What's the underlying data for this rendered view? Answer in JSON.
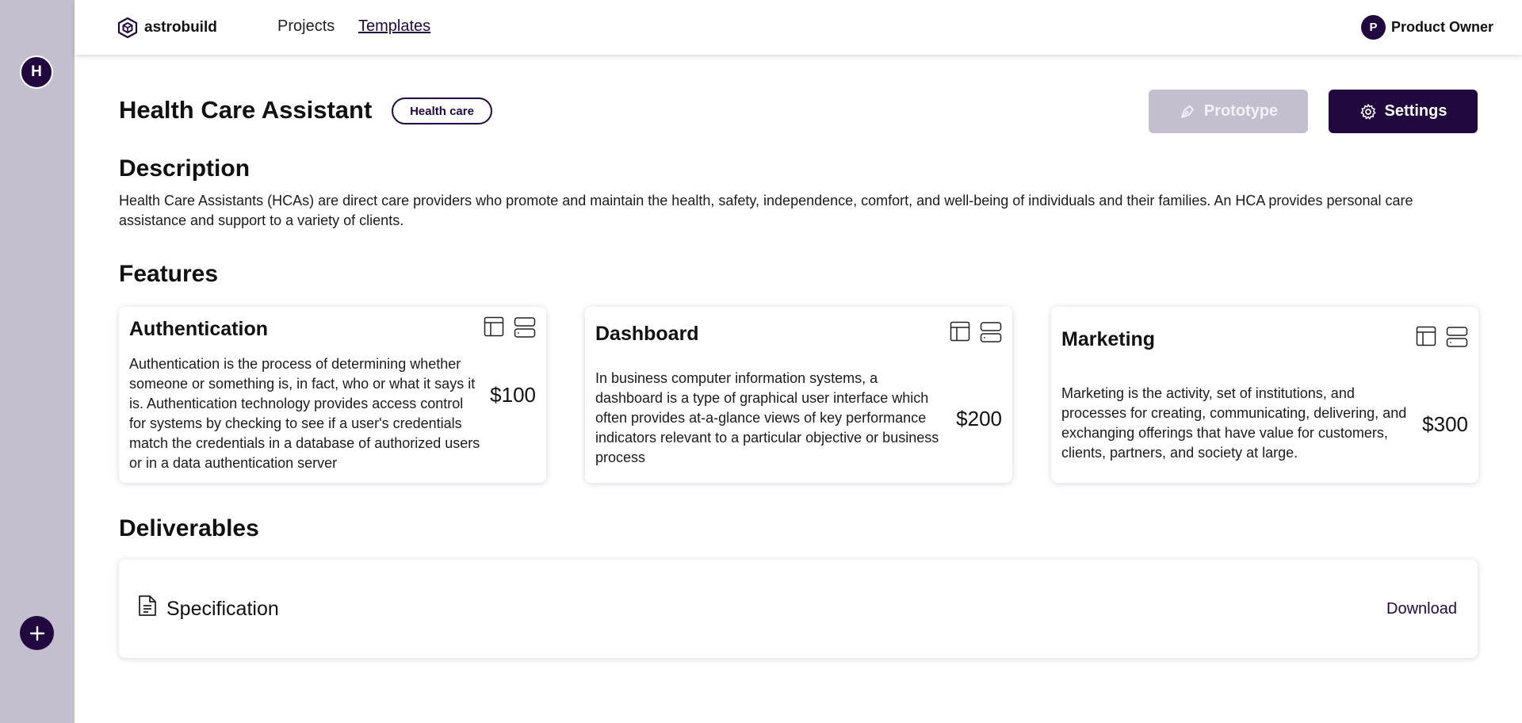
{
  "sidebar": {
    "workspace_initial": "H"
  },
  "header": {
    "logo": "astrobuild",
    "nav": [
      "Projects",
      "Templates"
    ],
    "user": {
      "initial": "P",
      "name": "Product Owner"
    }
  },
  "template": {
    "title": "Health Care Assistant",
    "tag": "Health care",
    "prototype_label": "Prototype",
    "settings_label": "Settings"
  },
  "description": {
    "heading": "Description",
    "text": "Health Care Assistants (HCAs) are direct care providers who promote and maintain the health, safety, independence, comfort, and well-being of individuals and their families. An HCA provides personal care assistance and support to a variety of clients."
  },
  "features": {
    "heading": "Features",
    "items": [
      {
        "title": "Authentication",
        "description": "Authentication is the process of determining whether someone or something is, in fact, who or what it says it is. Authentication technology provides access control for systems by checking to see if a user's credentials match the credentials in a database of authorized users or in a data authentication server",
        "price": "$100"
      },
      {
        "title": "Dashboard",
        "description": "In business computer information systems, a dashboard is a type of graphical user interface which often provides at-a-glance views of key performance indicators relevant to a particular objective or business process",
        "price": "$200"
      },
      {
        "title": "Marketing",
        "description": "Marketing is the activity, set of institutions, and processes for creating, communicating, delivering, and exchanging offerings that have value for customers, clients, partners, and society at large.",
        "price": "$300"
      }
    ]
  },
  "deliverables": {
    "heading": "Deliverables",
    "items": [
      {
        "name": "Specification",
        "action": "Download"
      }
    ]
  },
  "colors": {
    "brand_dark": "#21093f",
    "sidebar_bg": "#c4bfcf",
    "disabled_button": "#c4bfcf"
  },
  "icons": [
    "hexagon-logo-icon",
    "plus-icon",
    "pen-tool-icon",
    "gear-icon",
    "layout-icon",
    "server-icon",
    "document-icon"
  ]
}
